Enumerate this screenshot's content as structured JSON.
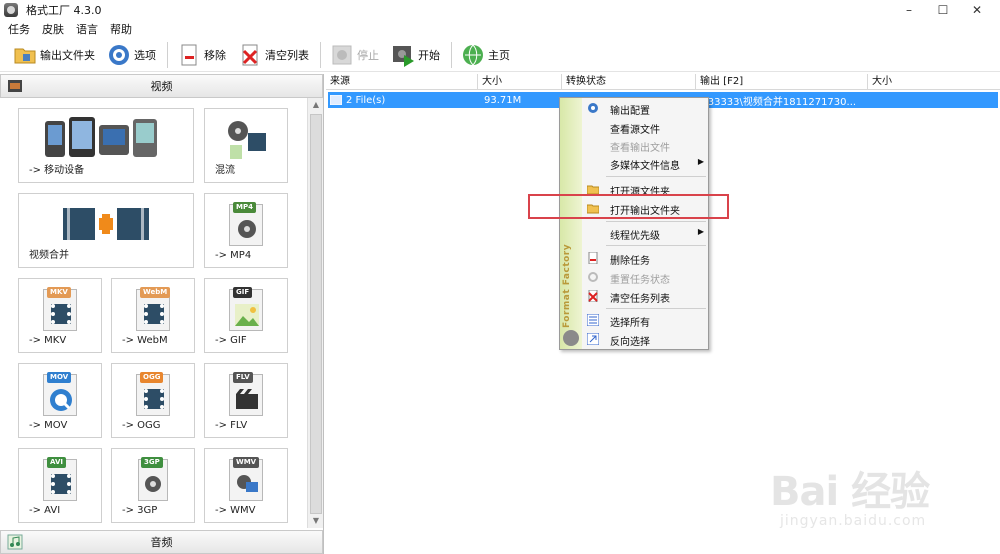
{
  "window": {
    "title": "格式工厂 4.3.0",
    "controls": [
      "–",
      "☐",
      "✕"
    ]
  },
  "menu": [
    "任务",
    "皮肤",
    "语言",
    "帮助"
  ],
  "toolbar": [
    {
      "name": "output-folder-button",
      "label": "输出文件夹",
      "icon": "folder-icon",
      "disabled": false
    },
    {
      "name": "options-button",
      "label": "选项",
      "icon": "gear-icon",
      "disabled": false
    },
    {
      "name": "remove-button",
      "label": "移除",
      "icon": "remove-doc-icon",
      "disabled": false
    },
    {
      "name": "clear-list-button",
      "label": "清空列表",
      "icon": "clear-x-icon",
      "disabled": false
    },
    {
      "name": "stop-button",
      "label": "停止",
      "icon": "stop-icon",
      "disabled": true
    },
    {
      "name": "start-button",
      "label": "开始",
      "icon": "play-icon",
      "disabled": false
    },
    {
      "name": "home-button",
      "label": "主页",
      "icon": "globe-icon",
      "disabled": false
    }
  ],
  "left_panel": {
    "video_header": "视频",
    "tiles": [
      {
        "label": "-> 移动设备",
        "icon": "mobile-devices-icon"
      },
      {
        "label": "混流",
        "icon": "mux-icon"
      },
      {
        "label": "视频合并",
        "icon": "video-merge-icon"
      },
      {
        "label": "-> MP4",
        "icon": "mp4-file-icon",
        "tag": "MP4",
        "tag_color": "#4a8a3a"
      },
      {
        "label": "-> MKV",
        "icon": "mkv-file-icon",
        "tag": "MKV",
        "tag_color": "#e39a55"
      },
      {
        "label": "-> WebM",
        "icon": "webm-file-icon",
        "tag": "WebM",
        "tag_color": "#e39a55"
      },
      {
        "label": "-> GIF",
        "icon": "gif-file-icon",
        "tag": "GIF",
        "tag_color": "#333333"
      },
      {
        "label": "-> MOV",
        "icon": "mov-file-icon",
        "tag": "MOV",
        "tag_color": "#2f7fcf"
      },
      {
        "label": "-> OGG",
        "icon": "ogg-file-icon",
        "tag": "OGG",
        "tag_color": "#e8862e"
      },
      {
        "label": "-> FLV",
        "icon": "flv-file-icon",
        "tag": "FLV",
        "tag_color": "#555555"
      },
      {
        "label": "-> AVI",
        "icon": "avi-file-icon",
        "tag": "AVI",
        "tag_color": "#3f8f3f"
      },
      {
        "label": "-> 3GP",
        "icon": "3gp-file-icon",
        "tag": "3GP",
        "tag_color": "#3f8f3f"
      },
      {
        "label": "-> WMV",
        "icon": "wmv-file-icon",
        "tag": "WMV",
        "tag_color": "#555555"
      }
    ],
    "audio_header": "音频"
  },
  "task_list": {
    "columns": [
      "来源",
      "大小",
      "转换状态",
      "输出 [F2]",
      "大小"
    ],
    "rows": [
      {
        "source": "2 File(s)",
        "size": "93.71M",
        "status": "",
        "output": "\\q33333\\视频合并1811271730...",
        "out_size": ""
      }
    ]
  },
  "context_menu": {
    "brand": "Format Factory",
    "items": [
      {
        "label": "输出配置",
        "icon": "gear-icon",
        "disabled": false,
        "submenu": false
      },
      {
        "label": "查看源文件",
        "icon": "",
        "disabled": false,
        "submenu": false
      },
      {
        "label": "查看输出文件",
        "icon": "",
        "disabled": true,
        "submenu": false
      },
      {
        "label": "多媒体文件信息",
        "icon": "",
        "disabled": false,
        "submenu": true
      },
      {
        "label": "打开源文件夹",
        "icon": "folder-icon",
        "disabled": false,
        "submenu": false
      },
      {
        "label": "打开输出文件夹",
        "icon": "folder-icon",
        "disabled": false,
        "submenu": false,
        "highlighted": true
      },
      {
        "label": "线程优先级",
        "icon": "",
        "disabled": false,
        "submenu": true
      },
      {
        "label": "删除任务",
        "icon": "remove-doc-icon",
        "disabled": false,
        "submenu": false
      },
      {
        "label": "重置任务状态",
        "icon": "reset-icon",
        "disabled": true,
        "submenu": false
      },
      {
        "label": "清空任务列表",
        "icon": "clear-x-icon",
        "disabled": false,
        "submenu": false
      },
      {
        "label": "选择所有",
        "icon": "select-all-icon",
        "disabled": false,
        "submenu": false
      },
      {
        "label": "反向选择",
        "icon": "invert-select-icon",
        "disabled": false,
        "submenu": false
      }
    ],
    "submenu_arrow": "▶"
  },
  "watermark": {
    "logo": "Bai 经验",
    "url": "jingyan.baidu.com"
  }
}
